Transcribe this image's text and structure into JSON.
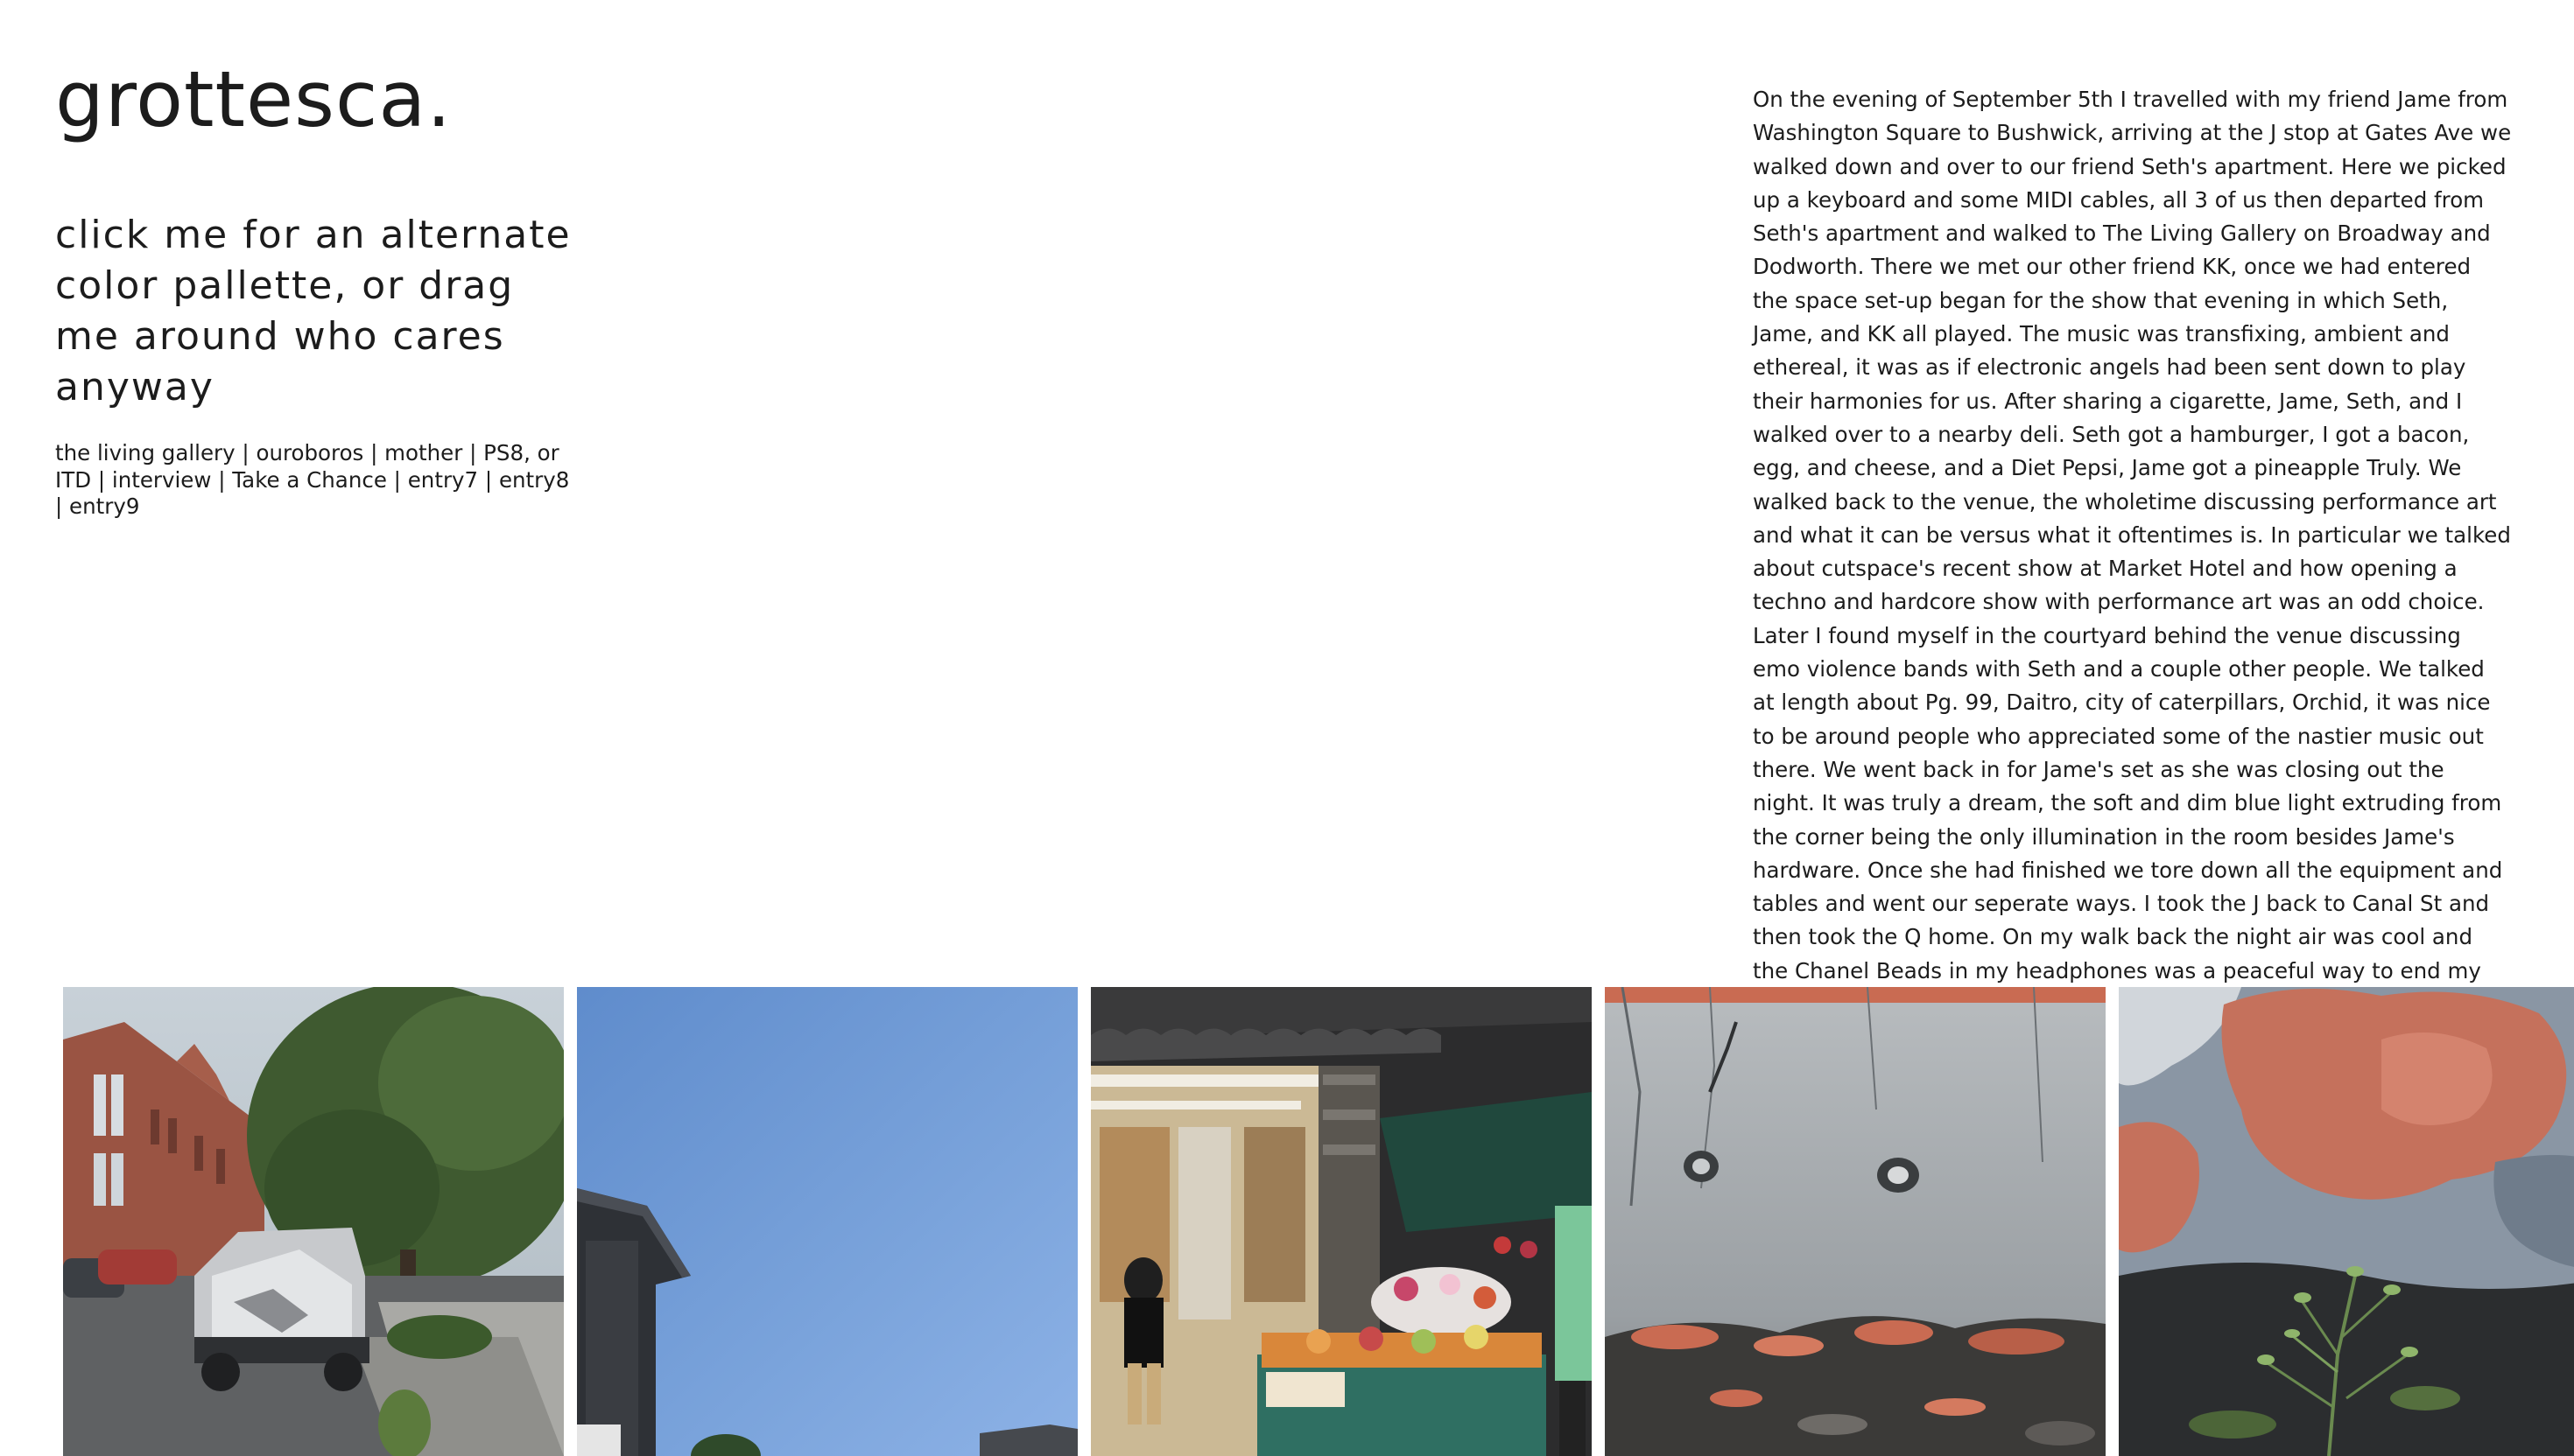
{
  "site": {
    "title": "grottesca."
  },
  "palette_toggle": {
    "text": "click me for an alternate color pallette, or drag me around who cares anyway"
  },
  "nav": {
    "links": [
      "the living gallery",
      "ouroboros",
      "mother",
      "PS8, or ITD",
      "interview",
      "Take a Chance",
      "entry7",
      "entry8",
      "entry9"
    ],
    "separator": " | "
  },
  "story": {
    "text": "On the evening of September 5th I travelled with my friend Jame from Washington Square to Bushwick, arriving at the J stop at Gates Ave we walked down and over to our friend Seth's apartment. Here we picked up a keyboard and some MIDI cables, all 3 of us then departed from Seth's apartment and walked to The Living Gallery on Broadway and Dodworth. There we met our other friend KK, once we had entered the space set-up began for the show that evening in which Seth, Jame, and KK all played. The music was transfixing, ambient and ethereal, it was as if electronic angels had been sent down to play their harmonies for us. After sharing a cigarette, Jame, Seth, and I walked over to a nearby deli. Seth got a hamburger, I got a bacon, egg, and cheese, and a Diet Pepsi, Jame got a pineapple Truly. We walked back to the venue, the wholetime discussing performance art and what it can be versus what it oftentimes is. In particular we talked about cutspace's recent show at Market Hotel and how opening a techno and hardcore show with performance art was an odd choice. Later I found myself in the courtyard behind the venue discussing emo violence bands with Seth and a couple other people. We talked at length about Pg. 99, Daitro, city of caterpillars, Orchid, it was nice to be around people who appreciated some of the nastier music out there. We went back in for Jame's set as she was closing out the night. It was truly a dream, the soft and dim blue light extruding from the corner being the only illumination in the room besides Jame's hardware. Once she had finished we tore down all the equipment and tables and went our seperate ways. I took the J back to Canal St and then took the Q home. On my walk back the night air was cool and the Chanel Beads in my headphones was a peaceful way to end my journey."
  },
  "gallery": {
    "photos": [
      {
        "name": "street-wrecked-car-photo",
        "palette": [
          "#b9c6cf",
          "#8a4a3a",
          "#4f6a3e",
          "#6b6b6b",
          "#c9c9c9"
        ]
      },
      {
        "name": "blue-sky-rooftop-photo",
        "palette": [
          "#6f9bd6",
          "#8fb3e6",
          "#3a3d42",
          "#2b2e33"
        ]
      },
      {
        "name": "deli-flower-stand-photo",
        "palette": [
          "#2f2f30",
          "#e8e2d3",
          "#2f6f62",
          "#d9873a",
          "#c74a4a"
        ]
      },
      {
        "name": "rusty-wall-closeup-photo",
        "palette": [
          "#a9adb0",
          "#7d8286",
          "#3b3a38",
          "#c96b52"
        ]
      },
      {
        "name": "peeling-paint-plant-photo",
        "palette": [
          "#8a96a4",
          "#c5715c",
          "#2b2d2f",
          "#6a8a4f"
        ]
      }
    ]
  }
}
